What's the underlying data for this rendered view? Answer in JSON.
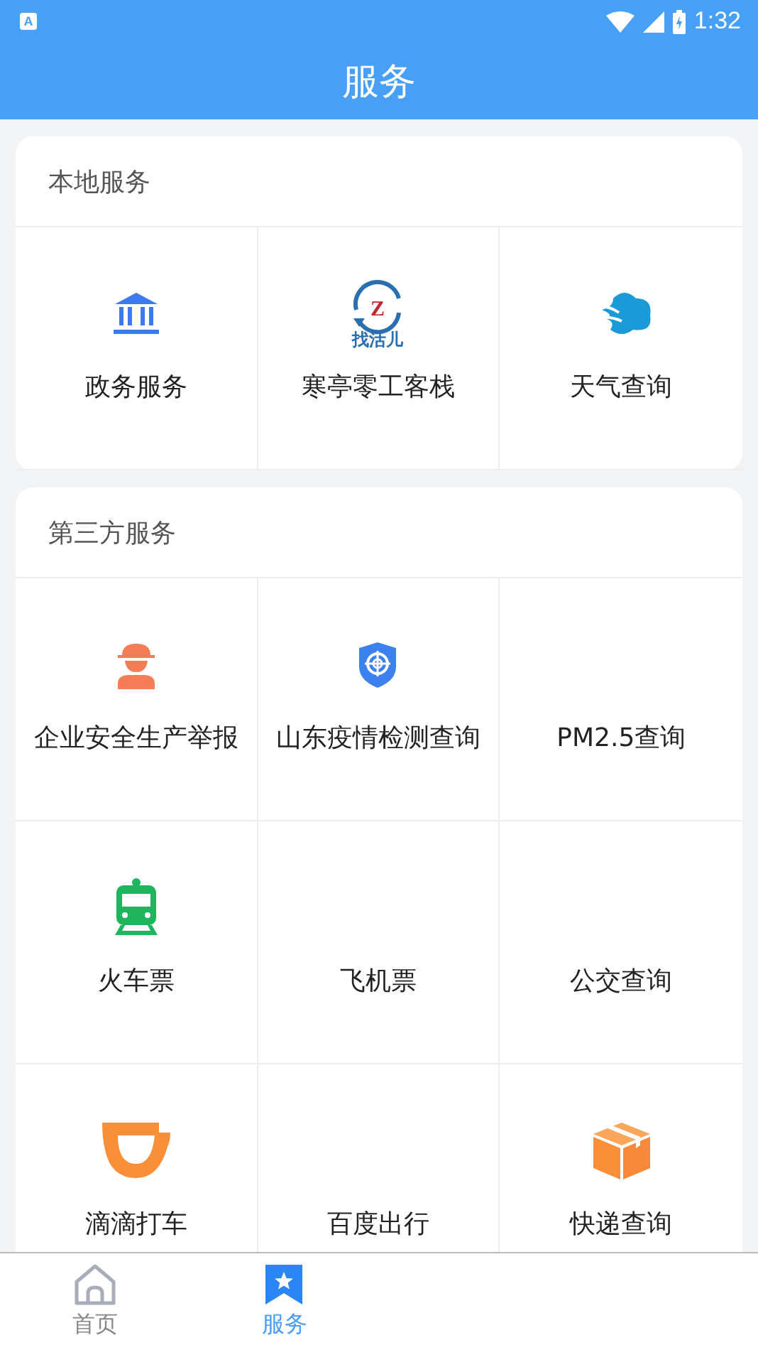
{
  "status_bar": {
    "app_badge": "A",
    "time": "1:32"
  },
  "header": {
    "title": "服务"
  },
  "sections": [
    {
      "title": "本地服务",
      "items": [
        {
          "label": "政务服务"
        },
        {
          "label": "寒亭零工客栈",
          "logo_letter": "Z",
          "logo_text": "找活儿"
        },
        {
          "label": "天气查询"
        }
      ]
    },
    {
      "title": "第三方服务",
      "items": [
        {
          "label": "企业安全生产举报"
        },
        {
          "label": "山东疫情检测查询"
        },
        {
          "label": "PM2.5查询"
        },
        {
          "label": "火车票"
        },
        {
          "label": "飞机票"
        },
        {
          "label": "公交查询"
        },
        {
          "label": "滴滴打车"
        },
        {
          "label": "百度出行"
        },
        {
          "label": "快递查询"
        }
      ]
    }
  ],
  "bottom_nav": [
    {
      "label": "首页",
      "selected": false
    },
    {
      "label": "服务",
      "selected": true
    }
  ]
}
